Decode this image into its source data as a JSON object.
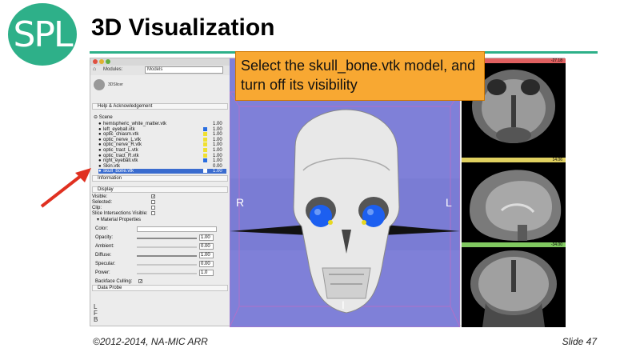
{
  "slide": {
    "logo": "SPL",
    "title": "3D Visualization",
    "footer_left": "©2012-2014, NA-MIC ARR",
    "footer_right": "Slide 47",
    "callout": "Select the skull_bone.vtk model, and turn off its visibility",
    "accent_color": "#2eb089"
  },
  "app": {
    "modules_label": "Modules:",
    "module_selected": "Models",
    "brand": "3DSlicer",
    "sections": {
      "help": "Help & Acknowledgement",
      "information": "Information",
      "display": "Display",
      "data_probe": "Data Probe"
    },
    "scene_label": "Scene",
    "models": [
      {
        "name": "hemispheric_white_matter.vtk",
        "opacity": "1.00",
        "color": ""
      },
      {
        "name": "left_eyeball.vtk",
        "opacity": "1.00",
        "color": "#2a6ee0"
      },
      {
        "name": "optic_chiasm.vtk",
        "opacity": "1.00",
        "color": "#f0e030"
      },
      {
        "name": "optic_nerve_L.vtk",
        "opacity": "1.00",
        "color": "#f0e030"
      },
      {
        "name": "optic_nerve_R.vtk",
        "opacity": "1.00",
        "color": "#f0e030"
      },
      {
        "name": "optic_tract_L.vtk",
        "opacity": "1.00",
        "color": "#f0e030"
      },
      {
        "name": "optic_tract_R.vtk",
        "opacity": "1.00",
        "color": "#f0e030"
      },
      {
        "name": "right_eyeball.vtk",
        "opacity": "1.00",
        "color": "#2a6ee0"
      },
      {
        "name": "Skin.vtk",
        "opacity": "0.00",
        "color": ""
      },
      {
        "name": "skull_bone.vtk",
        "opacity": "1.00",
        "color": "#ffffff"
      }
    ],
    "display": {
      "visible": "Visible:",
      "selected": "Selected:",
      "clip": "Clip:",
      "slice_intersections": "Slice Intersections Visible:",
      "material": "Material Properties",
      "color": "Color:",
      "opacity": "Opacity:",
      "opacity_val": "1.00",
      "ambient": "Ambient:",
      "ambient_val": "0.00",
      "diffuse": "Diffuse:",
      "diffuse_val": "1.00",
      "specular": "Specular:",
      "specular_val": "0.00",
      "power": "Power:",
      "power_val": "1.0",
      "backface": "Backface Culling:"
    },
    "coords": [
      "L",
      "F",
      "B"
    ],
    "view3d": {
      "label_r": "R",
      "label_l": "L",
      "label_i": "I"
    },
    "slice_values": {
      "red": "-27.18",
      "yellow": "14.06",
      "green": "-34.00"
    }
  }
}
